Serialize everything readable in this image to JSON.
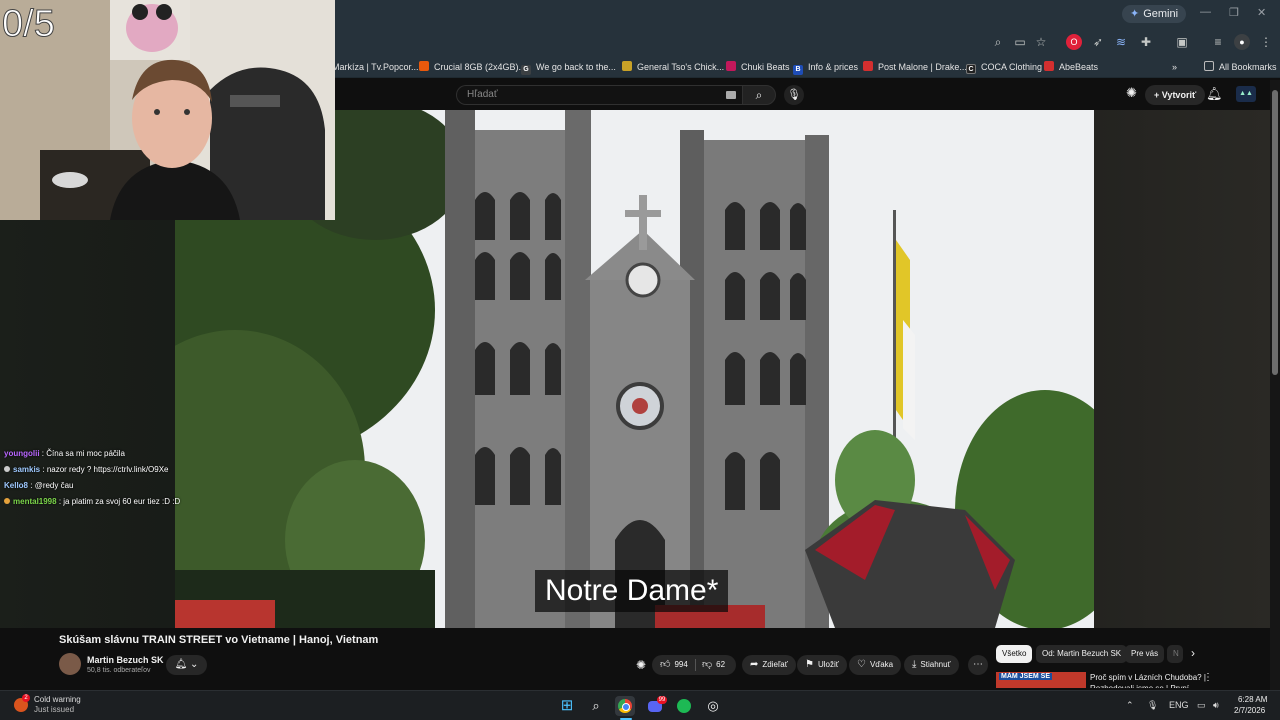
{
  "browser": {
    "gemini_label": "Gemini",
    "bookmarks": [
      {
        "label": "Markíza | Tv.Popcor..."
      },
      {
        "label": "Crucial 8GB (2x4GB)..."
      },
      {
        "label": "We go back to the..."
      },
      {
        "label": "General Tso's Chick..."
      },
      {
        "label": "Chuki Beats"
      },
      {
        "label": "Info & prices"
      },
      {
        "label": "Post Malone | Drake..."
      },
      {
        "label": "COCA Clothing"
      },
      {
        "label": "AbeBeats"
      }
    ],
    "all_bookmarks": "All Bookmarks"
  },
  "youtube": {
    "search_placeholder": "Hľadať",
    "create_label": "Vytvoriť"
  },
  "stream": {
    "counter": "0/5",
    "chat": [
      {
        "user": "youngolii",
        "text": ": Čína sa mi moc páčila",
        "color": "#b967ff",
        "badge": false
      },
      {
        "user": "samkis",
        "text": ": nazor redy ? https://ctrlv.link/O9Xe",
        "color": "#9ec9ff",
        "badge": true
      },
      {
        "user": "Kello8",
        "text": ": @redy čau",
        "color": "#9ec9ff",
        "badge": false
      },
      {
        "user": "mental1998",
        "text": ": ja platim za svoj 60 eur tiez :D :D",
        "color": "#7bd54a",
        "badge": true
      }
    ]
  },
  "video": {
    "subtitle": "Notre Dame*",
    "title": "Skúšam slávnu TRAIN STREET vo Vietname | Hanoj, Vietnam",
    "channel_name": "Martin Bezuch SK",
    "subscribers": "50,8 tis. odberateľov",
    "likes": "994",
    "dislikes": "62",
    "share": "Zdieľať",
    "save": "Uložiť",
    "thanks": "Vďaka",
    "download": "Stiahnuť"
  },
  "chips": [
    "Všetko",
    "Od: Martin Bezuch SK",
    "Pre vás",
    "N"
  ],
  "recommended": {
    "thumb_text": "MÁM JSEM SE",
    "title": "Proč spím v Lázních Chudoba? | Rozhodovali jsme se | První"
  },
  "taskbar": {
    "weather_title": "Cold warning",
    "weather_sub": "Just issued",
    "weather_badge": "2",
    "discord_badge": "99",
    "lang": "ENG",
    "time": "6:28 AM",
    "date": "2/7/2026"
  }
}
